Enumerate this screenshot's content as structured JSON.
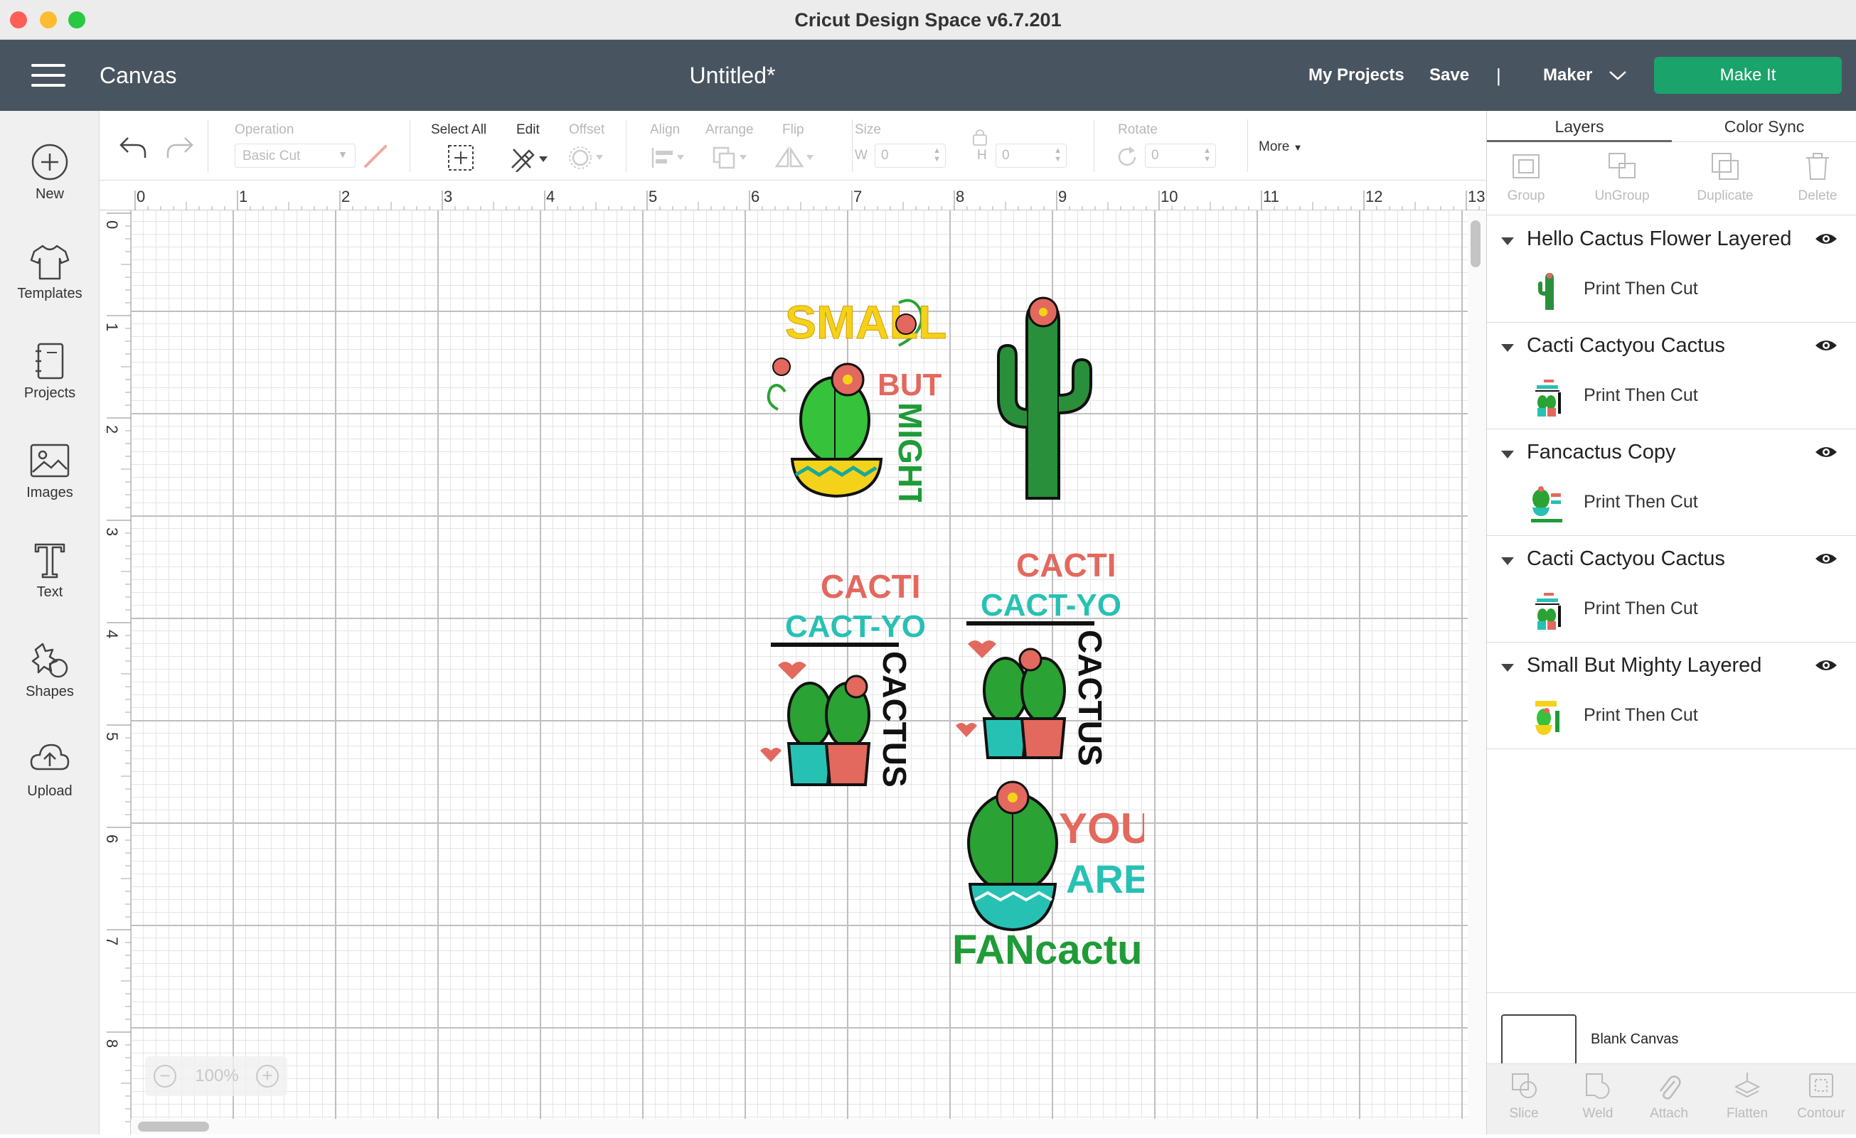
{
  "window": {
    "title": "Cricut Design Space  v6.7.201"
  },
  "header": {
    "canvas_label": "Canvas",
    "doc_title": "Untitled*",
    "my_projects": "My Projects",
    "save": "Save",
    "divider": "|",
    "machine": "Maker",
    "make_it": "Make It",
    "accent": "#1aa36b"
  },
  "sidebar": {
    "items": [
      {
        "label": "New",
        "icon": "plus-circle-icon"
      },
      {
        "label": "Templates",
        "icon": "tshirt-icon"
      },
      {
        "label": "Projects",
        "icon": "notebook-icon"
      },
      {
        "label": "Images",
        "icon": "image-icon"
      },
      {
        "label": "Text",
        "icon": "text-icon"
      },
      {
        "label": "Shapes",
        "icon": "shapes-icon"
      },
      {
        "label": "Upload",
        "icon": "cloud-upload-icon"
      }
    ]
  },
  "toolbar": {
    "operation_label": "Operation",
    "operation_value": "Basic Cut",
    "select_all": "Select All",
    "edit": "Edit",
    "offset": "Offset",
    "align": "Align",
    "arrange": "Arrange",
    "flip": "Flip",
    "size": "Size",
    "w_label": "W",
    "w_value": "0",
    "h_label": "H",
    "h_value": "0",
    "rotate": "Rotate",
    "rotate_value": "0",
    "more": "More"
  },
  "ruler": {
    "top": [
      "0",
      "1",
      "2",
      "3",
      "4",
      "5",
      "6",
      "7",
      "8",
      "9",
      "10",
      "11",
      "12",
      "13"
    ],
    "left": [
      "0",
      "1",
      "2",
      "3",
      "4",
      "5",
      "6",
      "7",
      "8"
    ]
  },
  "zoom": {
    "value": "100%",
    "minus": "−",
    "plus": "+"
  },
  "designs": {
    "small_but_mighty": {
      "line1": "SMALL",
      "line2": "BUT",
      "line3": "MIGHTY"
    },
    "cacti_1": {
      "line1": "CACTI",
      "line2": "CACT-YOU",
      "line3": "CACTUS"
    },
    "cacti_2": {
      "line1": "CACTI",
      "line2": "CACT-YOU",
      "line3": "CACTUS"
    },
    "fancactus": {
      "line1": "YOU",
      "line2": "ARE",
      "line3": "FANcactus"
    }
  },
  "panel": {
    "tabs": [
      "Layers",
      "Color Sync"
    ],
    "actions": [
      "Group",
      "UnGroup",
      "Duplicate",
      "Delete"
    ],
    "layers": [
      {
        "name": "Hello Cactus Flower Layered",
        "sub": "Print Then Cut"
      },
      {
        "name": "Cacti Cactyou Cactus",
        "sub": "Print Then Cut"
      },
      {
        "name": "Fancactus Copy",
        "sub": "Print Then Cut"
      },
      {
        "name": "Cacti Cactyou Cactus",
        "sub": "Print Then Cut"
      },
      {
        "name": "Small But Mighty Layered",
        "sub": "Print Then Cut"
      }
    ],
    "blank_canvas": "Blank Canvas",
    "footer_actions": [
      "Slice",
      "Weld",
      "Attach",
      "Flatten",
      "Contour"
    ]
  }
}
